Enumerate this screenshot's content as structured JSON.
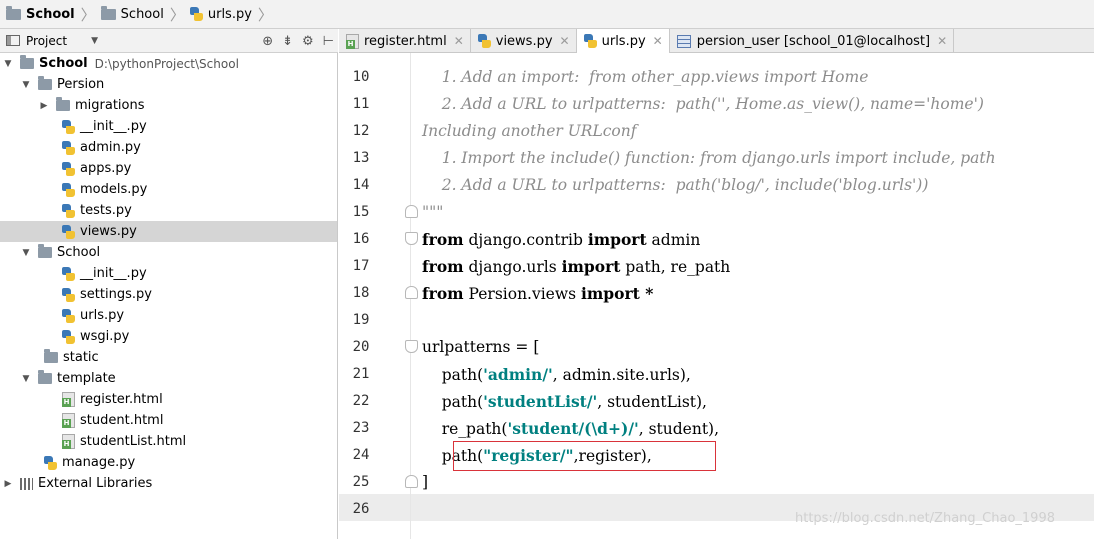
{
  "breadcrumbs": [
    "School",
    "School",
    "urls.py"
  ],
  "project_panel": {
    "title": "Project"
  },
  "tree": [
    {
      "label": "School",
      "hint": "D:\\pythonProject\\School",
      "type": "root"
    },
    {
      "label": "Persion",
      "type": "folder"
    },
    {
      "label": "migrations",
      "type": "folder"
    },
    {
      "label": "__init__.py",
      "type": "py"
    },
    {
      "label": "admin.py",
      "type": "py"
    },
    {
      "label": "apps.py",
      "type": "py"
    },
    {
      "label": "models.py",
      "type": "py"
    },
    {
      "label": "tests.py",
      "type": "py"
    },
    {
      "label": "views.py",
      "type": "py",
      "selected": true
    },
    {
      "label": "School",
      "type": "folder"
    },
    {
      "label": "__init__.py",
      "type": "py"
    },
    {
      "label": "settings.py",
      "type": "py"
    },
    {
      "label": "urls.py",
      "type": "py"
    },
    {
      "label": "wsgi.py",
      "type": "py"
    },
    {
      "label": "static",
      "type": "folder"
    },
    {
      "label": "template",
      "type": "folder"
    },
    {
      "label": "register.html",
      "type": "html"
    },
    {
      "label": "student.html",
      "type": "html"
    },
    {
      "label": "studentList.html",
      "type": "html"
    },
    {
      "label": "manage.py",
      "type": "py"
    },
    {
      "label": "External Libraries",
      "type": "lib"
    }
  ],
  "tabs": [
    {
      "label": "register.html",
      "icon": "html-file-icon"
    },
    {
      "label": "views.py",
      "icon": "python-file-icon"
    },
    {
      "label": "urls.py",
      "icon": "python-file-icon",
      "active": true
    },
    {
      "label": "persion_user [school_01@localhost]",
      "icon": "database-table-icon"
    }
  ],
  "editor": {
    "line_numbers": [
      "10",
      "11",
      "12",
      "13",
      "14",
      "15",
      "16",
      "17",
      "18",
      "19",
      "20",
      "21",
      "22",
      "23",
      "24",
      "25",
      "26"
    ],
    "lines": {
      "l10": "    1. Add an import:  from other_app.views import Home",
      "l11": "    2. Add a URL to urlpatterns:  path('', Home.as_view(), name='home')",
      "l12": "Including another URLconf",
      "l13": "    1. Import the include() function: from django.urls import include, path",
      "l14": "    2. Add a URL to urlpatterns:  path('blog/', include('blog.urls'))",
      "l15": "\"\"\"",
      "l16_kw1": "from",
      "l16_mid": " django.contrib ",
      "l16_kw2": "import",
      "l16_end": " admin",
      "l17_kw1": "from",
      "l17_mid": " django.urls ",
      "l17_kw2": "import",
      "l17_end": " path, re_path",
      "l18_kw1": "from",
      "l18_mid": " Persion.views ",
      "l18_kw2": "import",
      "l18_end": " *",
      "l20": "urlpatterns = [",
      "l21_a": "    path(",
      "l21_s": "'admin/'",
      "l21_b": ", admin.site.urls),",
      "l22_a": "    path(",
      "l22_s": "'studentList/'",
      "l22_b": ", studentList),",
      "l23_a": "    re_path(",
      "l23_s": "'student/(\\d+)/'",
      "l23_b": ", student),",
      "l24_a": "    path(",
      "l24_s": "\"register/\"",
      "l24_b": ",register),",
      "l25": "]"
    }
  },
  "watermark": "https://blog.csdn.net/Zhang_Chao_1998",
  "colors": {
    "string": "#008080",
    "comment": "#8c8c8c",
    "highlight_box": "#d9333a",
    "selection": "#d5d5d5"
  }
}
